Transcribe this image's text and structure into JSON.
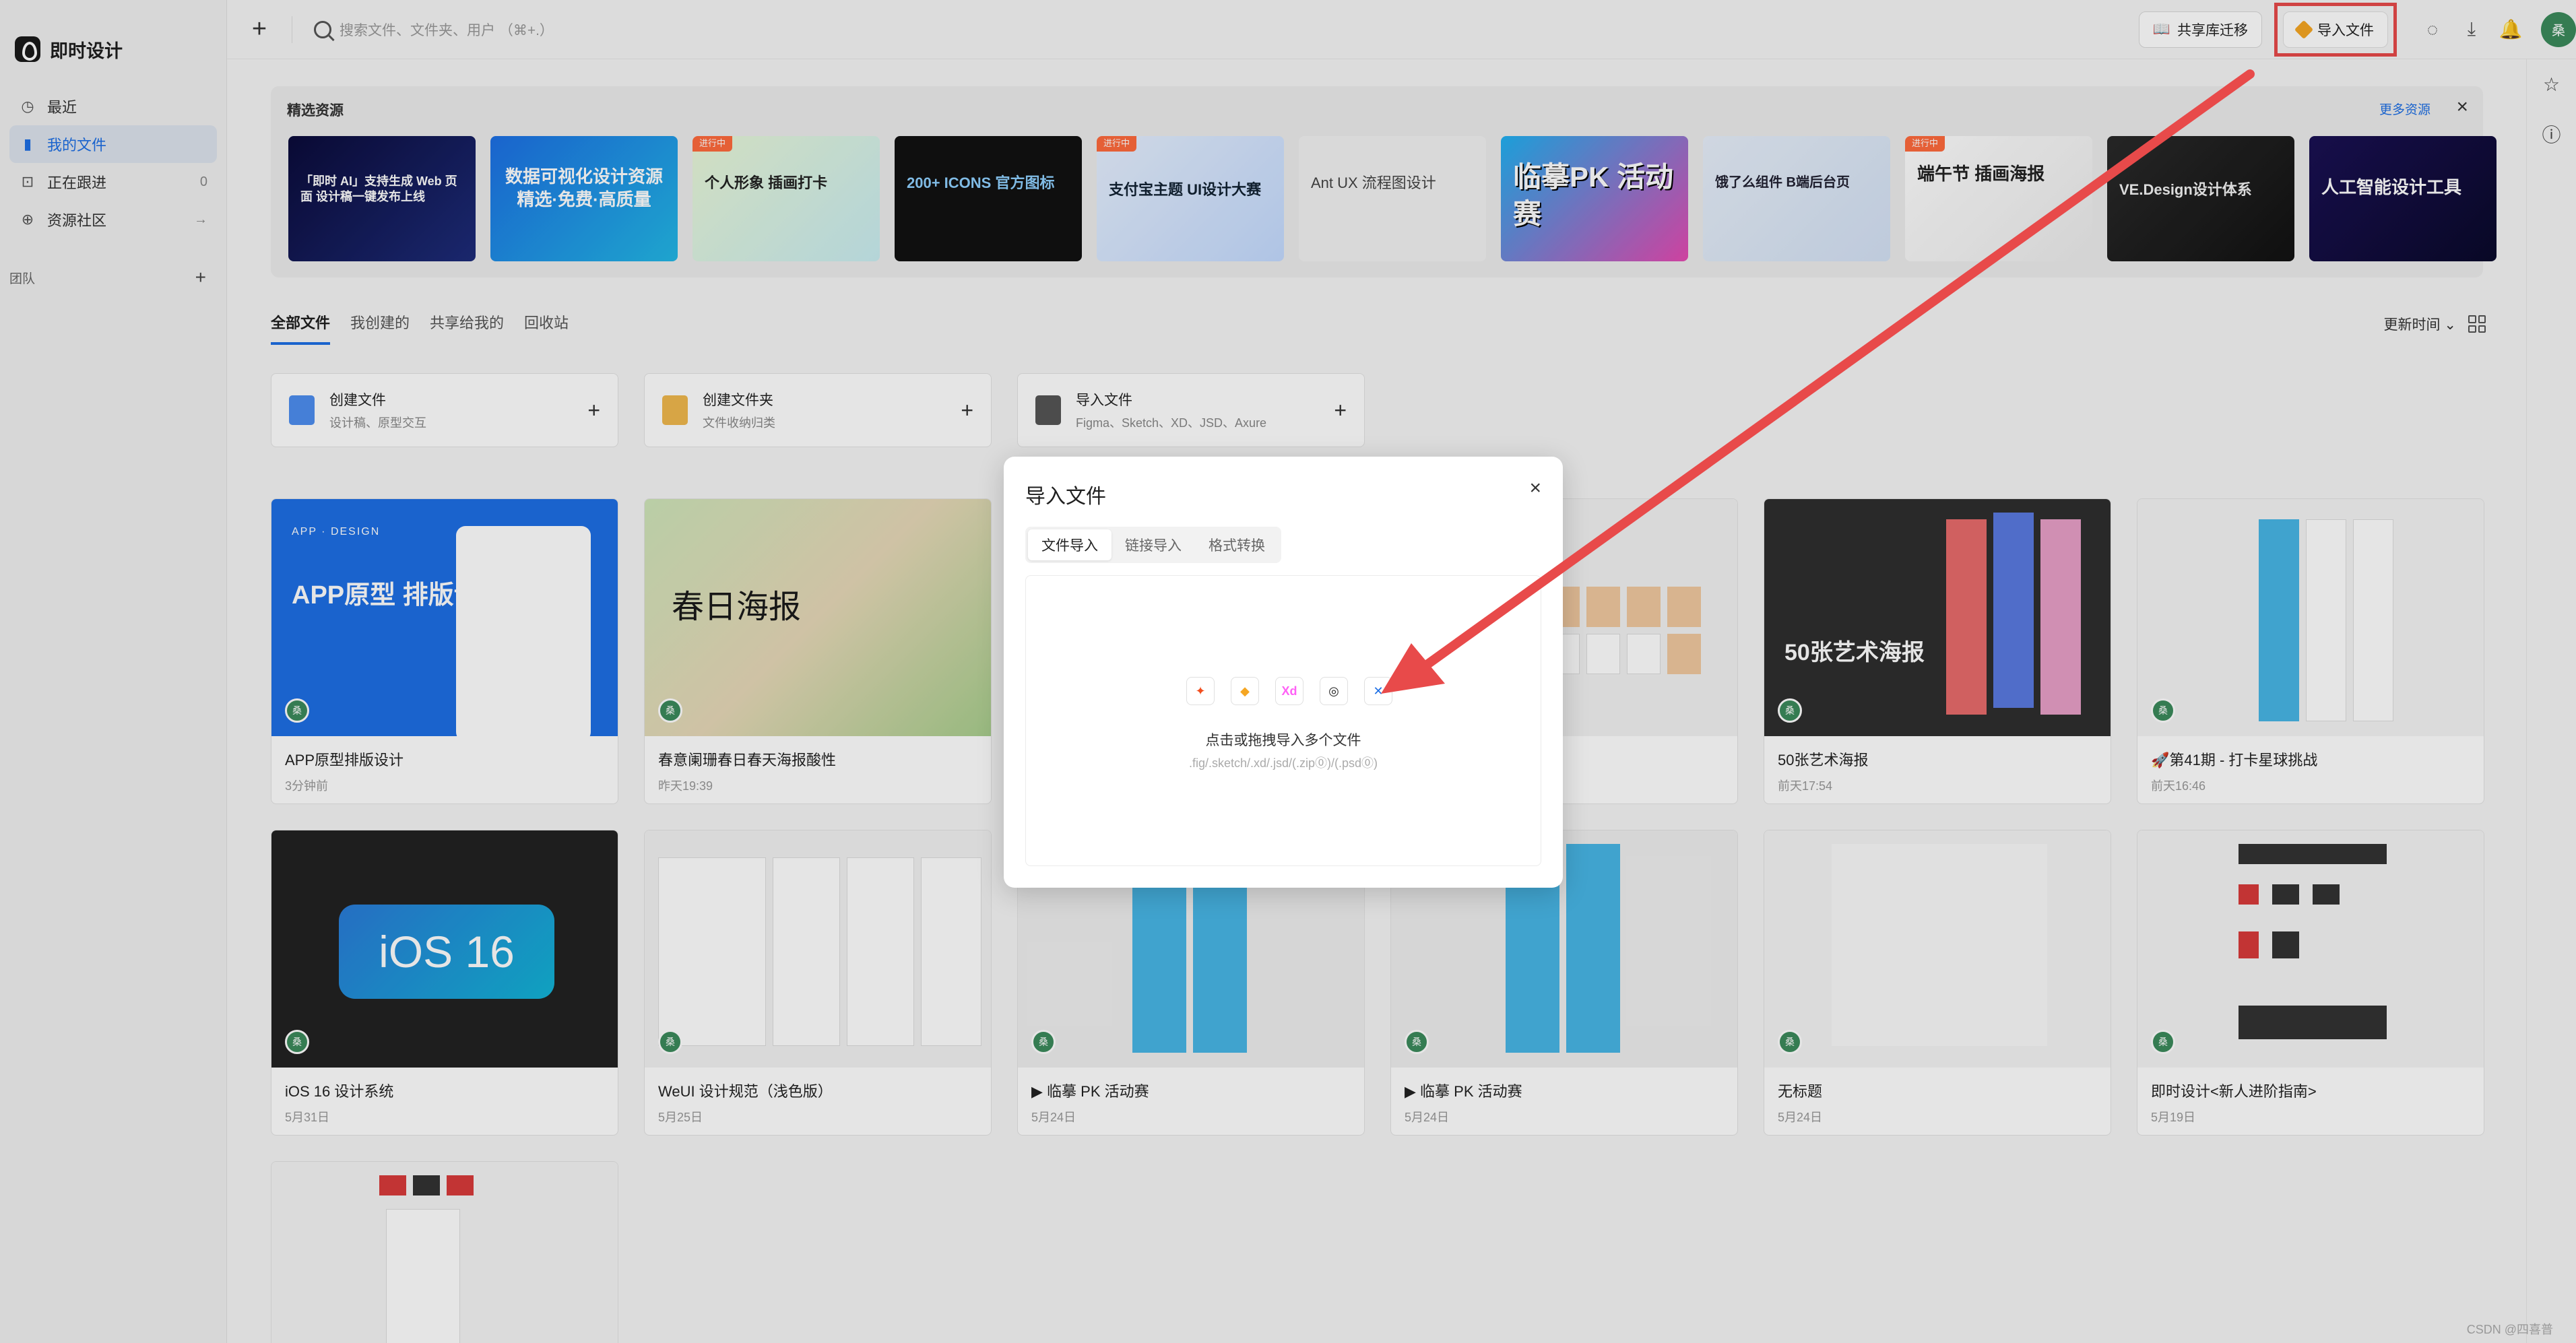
{
  "app": {
    "logo_text": "即时设计"
  },
  "sidebar": {
    "items": [
      {
        "label": "最近",
        "icon": "clock-icon",
        "right": ""
      },
      {
        "label": "我的文件",
        "icon": "file-icon",
        "right": ""
      },
      {
        "label": "正在跟进",
        "icon": "follow-icon",
        "right": "0"
      },
      {
        "label": "资源社区",
        "icon": "globe-icon",
        "right": "→"
      }
    ],
    "team_label": "团队"
  },
  "topbar": {
    "search_placeholder": "搜索文件、文件夹、用户 （⌘+.）",
    "share_migrate": "共享库迁移",
    "import_file": "导入文件",
    "avatar_text": "桑"
  },
  "featured": {
    "title": "精选资源",
    "more": "更多资源",
    "banners": [
      {
        "text": "「即时 AI」支持生成 Web 页面 设计稿一键发布上线",
        "tag": ""
      },
      {
        "text": "数据可视化设计资源 精选·免费·高质量",
        "tag": ""
      },
      {
        "text": "个人形象 插画打卡",
        "tag": "进行中"
      },
      {
        "text": "200+ ICONS 官方图标",
        "tag": ""
      },
      {
        "text": "支付宝主题 UI设计大赛",
        "tag": "进行中"
      },
      {
        "text": "Ant UX 流程图设计",
        "tag": ""
      },
      {
        "text": "临摹PK 活动赛",
        "tag": ""
      },
      {
        "text": "饿了么组件 B端后台页",
        "tag": ""
      },
      {
        "text": "端午节 插画海报",
        "tag": "进行中"
      },
      {
        "text": "VE.Design设计体系",
        "tag": ""
      },
      {
        "text": "人工智能设计工具",
        "tag": ""
      }
    ]
  },
  "tabs": [
    "全部文件",
    "我创建的",
    "共享给我的",
    "回收站"
  ],
  "sort_label": "更新时间",
  "actions": [
    {
      "title": "创建文件",
      "sub": "设计稿、原型交互",
      "color": "#4d8ef0"
    },
    {
      "title": "创建文件夹",
      "sub": "文件收纳归类",
      "color": "#f0b84d"
    },
    {
      "title": "导入文件",
      "sub": "Figma、Sketch、XD、JSD、Axure",
      "color": "#555555"
    }
  ],
  "files": [
    {
      "name": "APP原型排版设计",
      "date": "3分钟前",
      "thumb_title": "APP原型 排版设计",
      "thumb_sub": "APP · DESIGN"
    },
    {
      "name": "春意阑珊春日春天海报酸性",
      "date": "昨天19:39",
      "thumb_title": "春日海报",
      "thumb_sub": ""
    },
    {
      "name": "",
      "date": "",
      "thumb_title": "",
      "thumb_sub": ""
    },
    {
      "name": "",
      "date": "",
      "thumb_title": "",
      "thumb_sub": ""
    },
    {
      "name": "50张艺术海报",
      "date": "前天17:54",
      "thumb_title": "50张艺术海报",
      "thumb_sub": ""
    },
    {
      "name": "🚀第41期 - 打卡星球挑战",
      "date": "前天16:46",
      "thumb_title": "",
      "thumb_sub": ""
    },
    {
      "name": "iOS 16 设计系统",
      "date": "5月31日",
      "thumb_title": "iOS 16",
      "thumb_sub": ""
    },
    {
      "name": "WeUI 设计规范（浅色版）",
      "date": "5月25日",
      "thumb_title": "",
      "thumb_sub": ""
    },
    {
      "name": "▶ 临摹 PK 活动赛",
      "date": "5月24日",
      "thumb_title": "",
      "thumb_sub": ""
    },
    {
      "name": "▶ 临摹 PK 活动赛",
      "date": "5月24日",
      "thumb_title": "",
      "thumb_sub": ""
    },
    {
      "name": "无标题",
      "date": "5月24日",
      "thumb_title": "",
      "thumb_sub": ""
    },
    {
      "name": "即时设计<新人进阶指南>",
      "date": "5月19日",
      "thumb_title": "",
      "thumb_sub": ""
    }
  ],
  "modal": {
    "title": "导入文件",
    "tabs": [
      "文件导入",
      "链接导入",
      "格式转换"
    ],
    "drop_text": "点击或拖拽导入多个文件",
    "drop_sub": ".fig/.sketch/.xd/.jsd/(.zip⓪)/(.psd⓪)",
    "formats": [
      "figma-icon",
      "sketch-icon",
      "xd-icon",
      "jsd-icon",
      "axure-icon"
    ]
  },
  "watermark": "CSDN @四喜普"
}
